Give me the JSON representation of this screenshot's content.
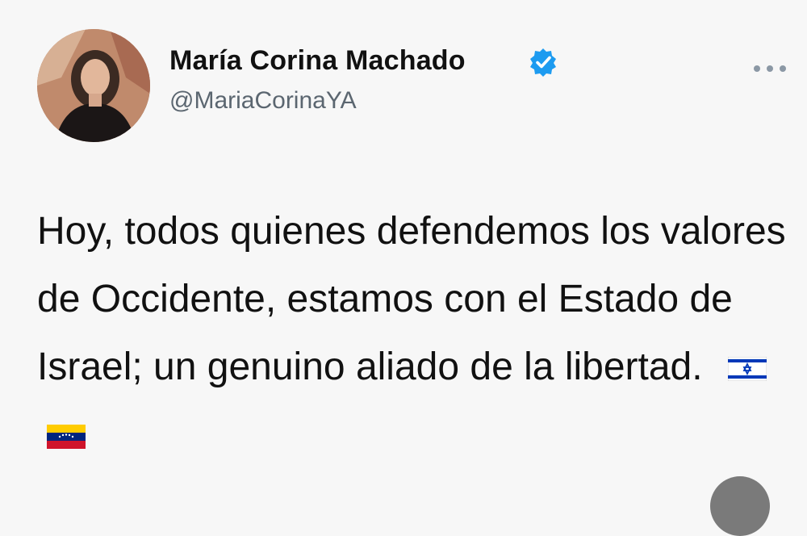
{
  "tweet": {
    "author": {
      "name": "María Corina Machado",
      "handle": "@MariaCorinaYA",
      "verified": true
    },
    "text": "Hoy, todos quienes defendemos los valores de Occidente, estamos con el Estado de Israel; un genuino aliado de la libertad.",
    "emojis": [
      "israel-flag-icon",
      "venezuela-flag-icon"
    ]
  },
  "colors": {
    "verified_badge": "#1d9bf0",
    "handle_text": "#5b6670",
    "background": "#f7f7f7"
  }
}
